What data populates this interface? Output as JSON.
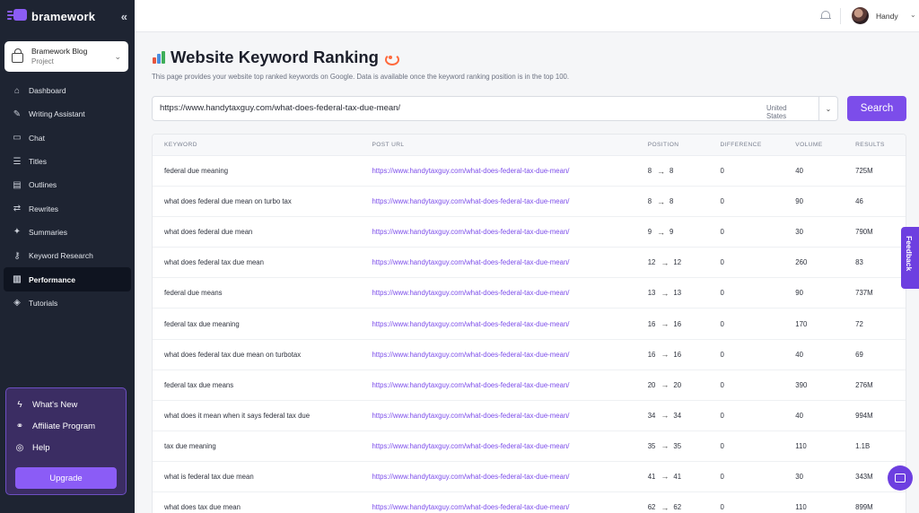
{
  "brand": {
    "name": "bramework",
    "collapse_icon": "double-chevron-left-icon"
  },
  "project": {
    "name": "Bramework Blog",
    "type": "Project"
  },
  "sidebar": {
    "items": [
      {
        "label": "Dashboard",
        "icon": "dashboard-icon"
      },
      {
        "label": "Writing Assistant",
        "icon": "pencil-icon"
      },
      {
        "label": "Chat",
        "icon": "chat-icon"
      },
      {
        "label": "Titles",
        "icon": "titles-icon"
      },
      {
        "label": "Outlines",
        "icon": "outline-icon"
      },
      {
        "label": "Rewrites",
        "icon": "rewrite-icon"
      },
      {
        "label": "Summaries",
        "icon": "sparkle-icon"
      },
      {
        "label": "Keyword Research",
        "icon": "key-icon"
      },
      {
        "label": "Performance",
        "icon": "chart-icon",
        "active": true
      },
      {
        "label": "Tutorials",
        "icon": "graduation-cap-icon"
      }
    ]
  },
  "promo": {
    "whats_new": "What's New",
    "affiliate": "Affiliate Program",
    "help": "Help",
    "upgrade": "Upgrade"
  },
  "topbar": {
    "username": "Handy"
  },
  "page": {
    "title": "Website Keyword Ranking",
    "subtitle": "This page provides your website top ranked keywords on Google. Data is available once the keyword ranking position is in the top 100."
  },
  "search": {
    "url": "https://www.handytaxguy.com/what-does-federal-tax-due-mean/",
    "country": "United States",
    "button": "Search"
  },
  "table": {
    "headers": [
      "KEYWORD",
      "POST URL",
      "POSITION",
      "DIFFERENCE",
      "VOLUME",
      "RESULTS"
    ],
    "rows": [
      {
        "keyword": "federal due meaning",
        "url": "https://www.handytaxguy.com/what-does-federal-tax-due-mean/",
        "pos_from": "8",
        "pos_to": "8",
        "difference": "0",
        "volume": "40",
        "results": "725M"
      },
      {
        "keyword": "what does federal due mean on turbo tax",
        "url": "https://www.handytaxguy.com/what-does-federal-tax-due-mean/",
        "pos_from": "8",
        "pos_to": "8",
        "difference": "0",
        "volume": "90",
        "results": "46"
      },
      {
        "keyword": "what does federal due mean",
        "url": "https://www.handytaxguy.com/what-does-federal-tax-due-mean/",
        "pos_from": "9",
        "pos_to": "9",
        "difference": "0",
        "volume": "30",
        "results": "790M"
      },
      {
        "keyword": "what does federal tax due mean",
        "url": "https://www.handytaxguy.com/what-does-federal-tax-due-mean/",
        "pos_from": "12",
        "pos_to": "12",
        "difference": "0",
        "volume": "260",
        "results": "83"
      },
      {
        "keyword": "federal due means",
        "url": "https://www.handytaxguy.com/what-does-federal-tax-due-mean/",
        "pos_from": "13",
        "pos_to": "13",
        "difference": "0",
        "volume": "90",
        "results": "737M"
      },
      {
        "keyword": "federal tax due meaning",
        "url": "https://www.handytaxguy.com/what-does-federal-tax-due-mean/",
        "pos_from": "16",
        "pos_to": "16",
        "difference": "0",
        "volume": "170",
        "results": "72"
      },
      {
        "keyword": "what does federal tax due mean on turbotax",
        "url": "https://www.handytaxguy.com/what-does-federal-tax-due-mean/",
        "pos_from": "16",
        "pos_to": "16",
        "difference": "0",
        "volume": "40",
        "results": "69"
      },
      {
        "keyword": "federal tax due means",
        "url": "https://www.handytaxguy.com/what-does-federal-tax-due-mean/",
        "pos_from": "20",
        "pos_to": "20",
        "difference": "0",
        "volume": "390",
        "results": "276M"
      },
      {
        "keyword": "what does it mean when it says federal tax due",
        "url": "https://www.handytaxguy.com/what-does-federal-tax-due-mean/",
        "pos_from": "34",
        "pos_to": "34",
        "difference": "0",
        "volume": "40",
        "results": "994M"
      },
      {
        "keyword": "tax due meaning",
        "url": "https://www.handytaxguy.com/what-does-federal-tax-due-mean/",
        "pos_from": "35",
        "pos_to": "35",
        "difference": "0",
        "volume": "110",
        "results": "1.1B"
      },
      {
        "keyword": "what is federal tax due mean",
        "url": "https://www.handytaxguy.com/what-does-federal-tax-due-mean/",
        "pos_from": "41",
        "pos_to": "41",
        "difference": "0",
        "volume": "30",
        "results": "343M"
      },
      {
        "keyword": "what does tax due mean",
        "url": "https://www.handytaxguy.com/what-does-federal-tax-due-mean/",
        "pos_from": "62",
        "pos_to": "62",
        "difference": "0",
        "volume": "110",
        "results": "899M"
      }
    ]
  },
  "feedback": "Feedback",
  "colors": {
    "accent": "#7c4dea",
    "sidebar": "#1e2432"
  }
}
